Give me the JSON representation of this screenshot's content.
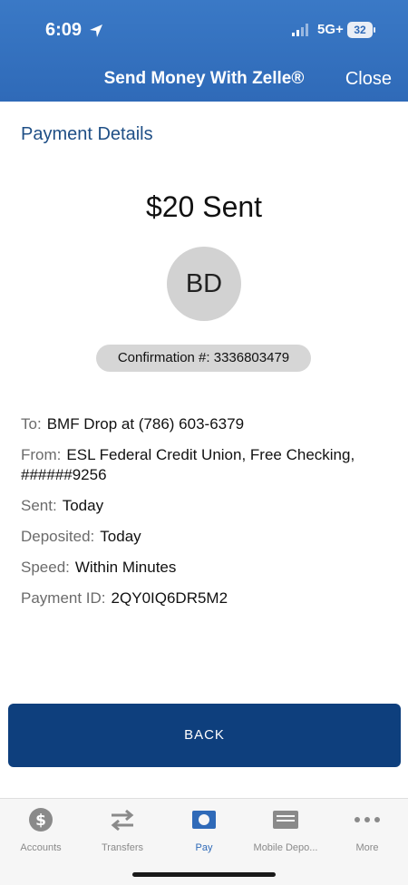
{
  "status_bar": {
    "time": "6:09",
    "network": "5G+",
    "battery": "32"
  },
  "header": {
    "title": "Send Money With Zelle®",
    "close_label": "Close"
  },
  "section_title": "Payment Details",
  "amount_text": "$20 Sent",
  "avatar_initials": "BD",
  "confirmation": "Confirmation #: 3336803479",
  "details": [
    {
      "label": "To:",
      "value": "BMF Drop at (786) 603-6379"
    },
    {
      "label": "From:",
      "value": "ESL Federal Credit Union, Free Checking, ######9256"
    },
    {
      "label": "Sent:",
      "value": "Today"
    },
    {
      "label": "Deposited:",
      "value": "Today"
    },
    {
      "label": "Speed:",
      "value": "Within Minutes"
    },
    {
      "label": "Payment ID:",
      "value": "2QY0IQ6DR5M2"
    }
  ],
  "back_label": "BACK",
  "tabs": [
    {
      "label": "Accounts",
      "icon": "dollar-circle-icon",
      "active": false
    },
    {
      "label": "Transfers",
      "icon": "transfer-arrows-icon",
      "active": false
    },
    {
      "label": "Pay",
      "icon": "pay-icon",
      "active": true
    },
    {
      "label": "Mobile Depo...",
      "icon": "check-deposit-icon",
      "active": false
    },
    {
      "label": "More",
      "icon": "more-dots-icon",
      "active": false
    }
  ],
  "colors": {
    "header_blue": "#2f6ab8",
    "button_navy": "#0e3f7d",
    "title_blue": "#1f4f86"
  }
}
